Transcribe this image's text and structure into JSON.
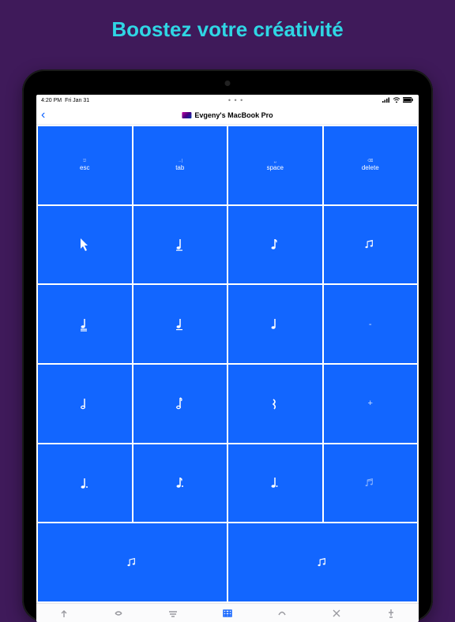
{
  "headline": "Boostez votre créativité",
  "status": {
    "time": "4:20 PM",
    "date": "Fri Jan 31"
  },
  "nav": {
    "title": "Evgeny's MacBook Pro"
  },
  "keys": {
    "row0": [
      {
        "mini": "⎋",
        "label": "esc"
      },
      {
        "mini": "→|",
        "label": "tab"
      },
      {
        "mini": "␣",
        "label": "space"
      },
      {
        "mini": "⌫",
        "label": "delete"
      }
    ]
  },
  "glyphs": {
    "dash": "-",
    "plus": "+"
  }
}
